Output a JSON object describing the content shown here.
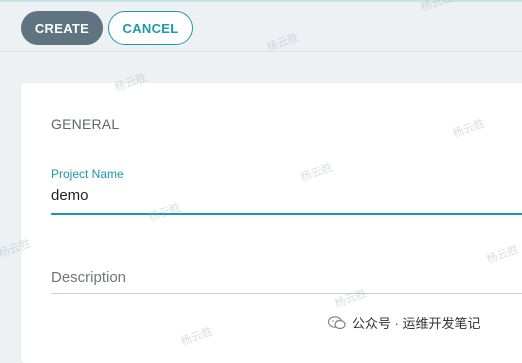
{
  "toolbar": {
    "create_label": "CREATE",
    "cancel_label": "CANCEL"
  },
  "form": {
    "section_title": "GENERAL",
    "project_name": {
      "label": "Project Name",
      "value": "demo"
    },
    "description": {
      "placeholder": "Description"
    }
  },
  "watermark": {
    "text": "杨云胜"
  },
  "footer": {
    "icon": "wechat-icon",
    "text": "公众号 · 运维开发笔记"
  },
  "colors": {
    "accent": "#1a9aaa",
    "primary_button": "#5f7380",
    "background": "#eef1f4"
  }
}
